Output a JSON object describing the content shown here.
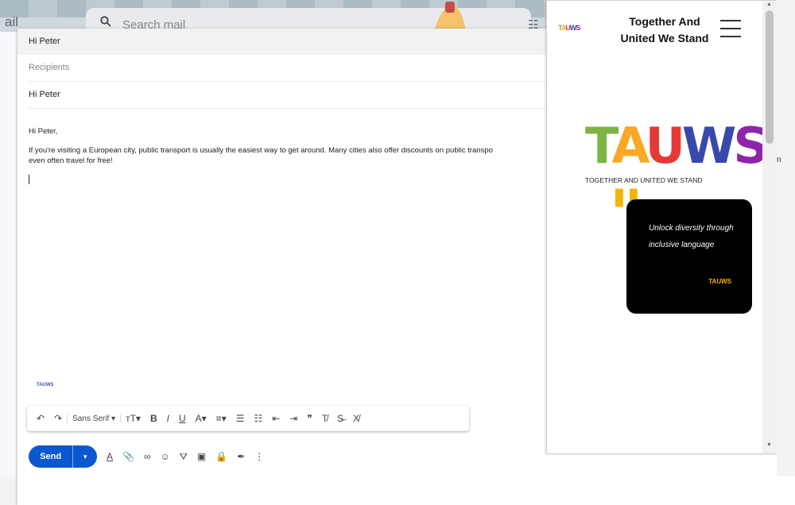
{
  "gmail": {
    "logo_fragment": "ail",
    "search_placeholder": "Search mail"
  },
  "compose": {
    "subject_header": "Hi Peter",
    "recipients_placeholder": "Recipients",
    "subject_field": "Hi Peter",
    "greeting": "Hi Peter,",
    "body": "If you're visiting a European city, public transport is usually the easiest way to get around. Many cities also offer discounts on public transpo",
    "body_line2": "even often travel for free!",
    "signature_logo": "TAUWS",
    "formatting": {
      "undo": "↶",
      "redo": "↷",
      "font": "Sans Serif",
      "font_caret": "▾",
      "size": "тT▾",
      "bold": "B",
      "italic": "I",
      "underline": "U",
      "text_color": "A▾",
      "align": "≡▾",
      "numbered_list": "☰",
      "bulleted_list": "☷",
      "indent_less": "⇤",
      "indent_more": "⇥",
      "quote": "❞",
      "clear_format": "T̸",
      "strikethrough": "S̶",
      "remove_format": "X̸"
    },
    "send_label": "Send",
    "send_more": "▾",
    "bottom_tools": {
      "text_format": "A",
      "attach": "📎",
      "link": "∞",
      "emoji": "☺",
      "drive": "⛛",
      "photo": "▣",
      "lock": "🔒",
      "signature": "✒",
      "more": "⋮"
    }
  },
  "extension": {
    "small_logo": "TAUWS",
    "title_line1": "Together And",
    "title_line2": "United We Stand",
    "big_logo_letters": [
      "T",
      "A",
      "U",
      "W",
      "S"
    ],
    "tagline": "TOGETHER AND UNITED WE STAND",
    "quote_mark": "\"",
    "quote_text": "Unlock diversity through inclusive language",
    "quote_author": "TAUWS",
    "scroll_up": "▲",
    "scroll_down": "▼"
  },
  "edge_text": "n",
  "colors": {
    "send_blue": "#0b57d0",
    "logo_green": "#7cb342",
    "logo_yellow": "#f9a825",
    "logo_red": "#e53935",
    "logo_blue": "#3949ab",
    "logo_purple": "#8e24aa",
    "quote_gold": "#f4b400"
  }
}
